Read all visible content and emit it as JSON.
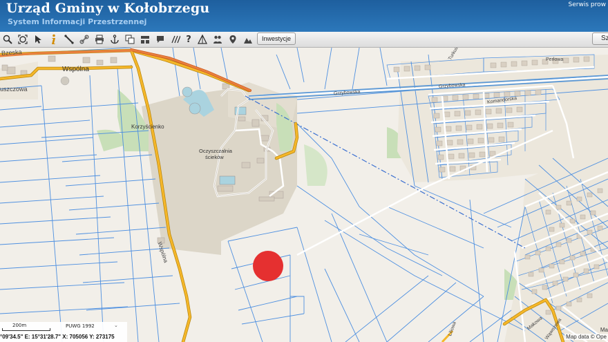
{
  "header": {
    "title": "Urząd Gminy w Kołobrzegu",
    "subtitle": "System Informacji Przestrzennej",
    "service_link": "Serwis prow"
  },
  "toolbar": {
    "icons": [
      "zoom-icon",
      "zoom-extent-icon",
      "select-arrow-icon",
      "info-icon",
      "measure-icon",
      "link-icon",
      "print-icon",
      "anchor-icon",
      "copy-icon",
      "layout-icon",
      "speech-bubble-icon",
      "hatch-icon",
      "help-icon",
      "triangle-icon",
      "people-icon",
      "marker-icon",
      "mountain-icon"
    ],
    "investments_label": "Inwestycje",
    "search_label": "Sz"
  },
  "map": {
    "labels": {
      "village": "Korzyścienko",
      "facility_line1": "Oczyszczalnia",
      "facility_line2": "ścieków",
      "street_wspolna_top": "Wspólna",
      "street_wspolna_side": "Wspólna",
      "street_grzybowska_1": "Grzybowska",
      "street_grzybowska_2": "Grzybowska",
      "street_top_left": "Bzeska",
      "street_left": "uszczowa",
      "street_turkusowa": "Turkusowa",
      "street_perlowa": "Perłowa",
      "street_komandorska": "Komandorska",
      "street_bottom_right_1": "Makowa",
      "street_bottom_right_2": "Wąwozowa",
      "street_bottom_mid": "Liliowa"
    },
    "marker_color": "#e53030",
    "parcel_color": "#4d8fe0",
    "road_color": "#f5b72a"
  },
  "scale": {
    "label": "200m",
    "crs": "PUWG 1992",
    "crs_arrow": "⌄",
    "coordinates": "°09'34.5\" E: 15°31'28.7\"  X: 705056     Y: 273175"
  },
  "attribution": {
    "ma": "Ma",
    "text": "Map data © Ope"
  }
}
